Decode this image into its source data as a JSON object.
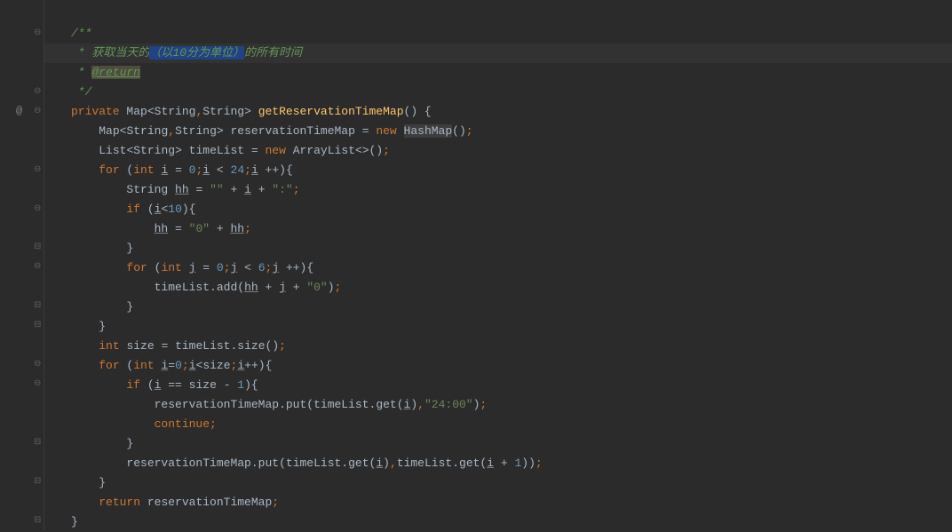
{
  "code": {
    "line1": "/**",
    "line2_pre": " * 获取当天的",
    "line2_sel": "（以10分为单位）",
    "line2_post": "的所有时间",
    "line3_pre": " * ",
    "line3_tag": "@return",
    "line4": " */",
    "kw_private": "private",
    "type_map": "Map",
    "type_string": "String",
    "method_name": "getReservationTimeMap",
    "var_map": "reservationTimeMap",
    "kw_new": "new",
    "type_hashmap": "HashMap",
    "type_list": "List",
    "var_timelist": "timeList",
    "type_arraylist": "ArrayList",
    "kw_for": "for",
    "kw_int": "int",
    "var_i": "i",
    "var_j": "j",
    "var_hh": "hh",
    "num_0": "0",
    "num_1": "1",
    "num_6": "6",
    "num_10": "10",
    "num_24": "24",
    "str_empty": "\"\"",
    "str_colon": "\":\"",
    "str_zero": "\"0\"",
    "str_2400": "\"24:00\"",
    "kw_if": "if",
    "kw_continue": "continue",
    "kw_return": "return",
    "var_size": "size",
    "method_add": "add",
    "method_size": "size",
    "method_put": "put",
    "method_get": "get"
  },
  "gutter": {
    "at_symbol": "@"
  }
}
